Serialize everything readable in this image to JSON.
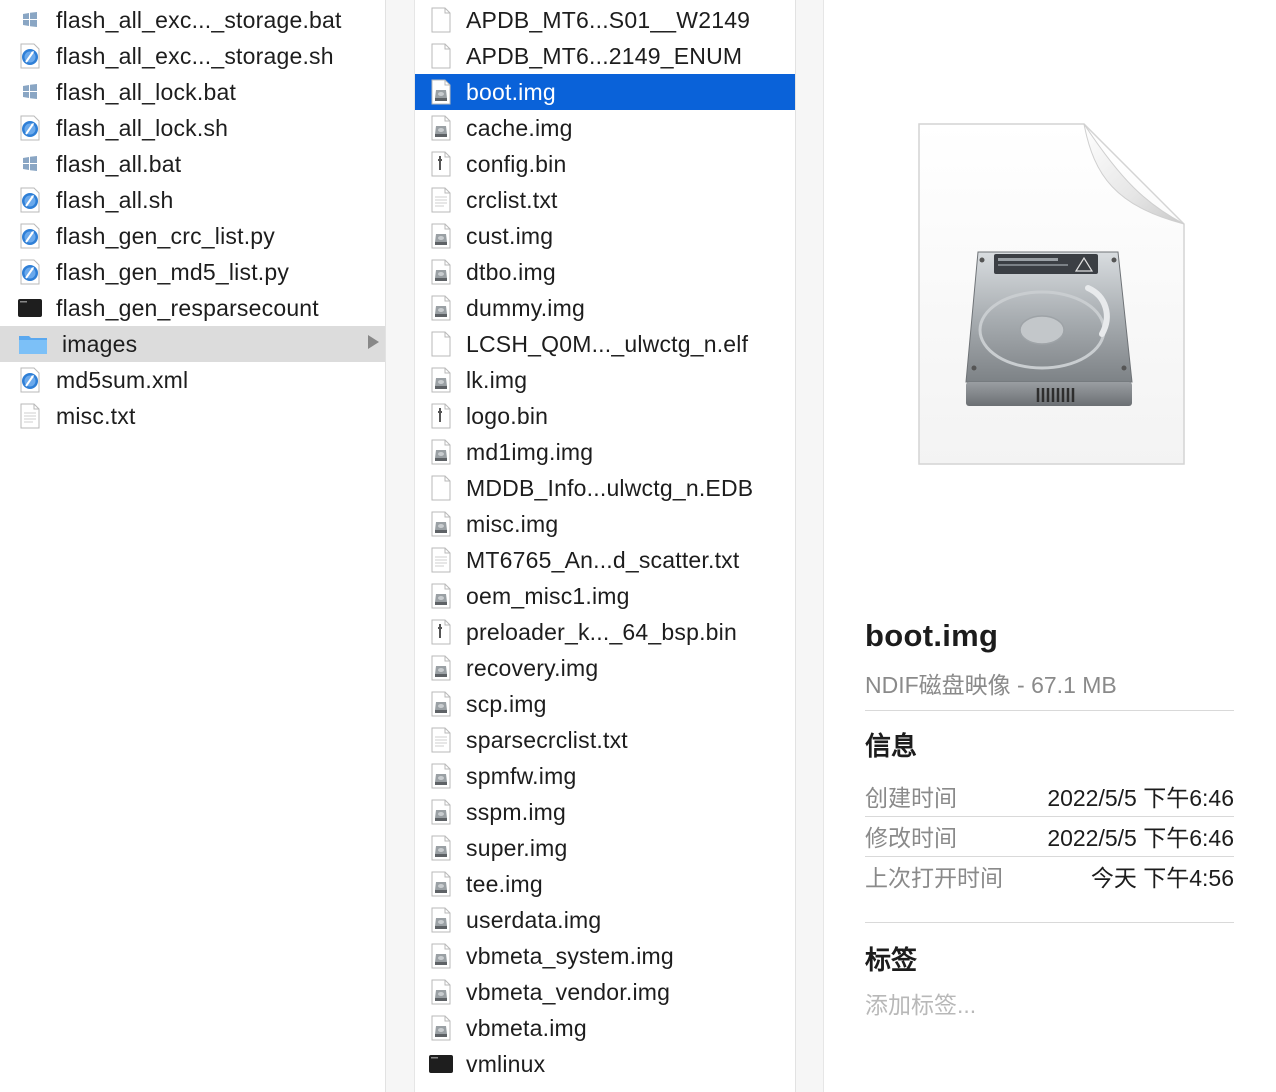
{
  "column1": {
    "items": [
      {
        "label": "flash_all_exc..._storage.bat",
        "icon": "windows-bat-icon"
      },
      {
        "label": "flash_all_exc..._storage.sh",
        "icon": "shell-script-icon"
      },
      {
        "label": "flash_all_lock.bat",
        "icon": "windows-bat-icon"
      },
      {
        "label": "flash_all_lock.sh",
        "icon": "shell-script-icon"
      },
      {
        "label": "flash_all.bat",
        "icon": "windows-bat-icon"
      },
      {
        "label": "flash_all.sh",
        "icon": "shell-script-icon"
      },
      {
        "label": "flash_gen_crc_list.py",
        "icon": "shell-script-icon"
      },
      {
        "label": "flash_gen_md5_list.py",
        "icon": "shell-script-icon"
      },
      {
        "label": "flash_gen_resparsecount",
        "icon": "terminal-exec-icon"
      },
      {
        "label": "images",
        "icon": "folder-icon"
      },
      {
        "label": "md5sum.xml",
        "icon": "shell-script-icon"
      },
      {
        "label": "misc.txt",
        "icon": "text-doc-icon"
      }
    ]
  },
  "column2": {
    "items": [
      {
        "label": "APDB_MT6...S01__W2149",
        "icon": "blank-doc-icon"
      },
      {
        "label": "APDB_MT6...2149_ENUM",
        "icon": "blank-doc-icon"
      },
      {
        "label": "boot.img",
        "icon": "disk-image-icon"
      },
      {
        "label": "cache.img",
        "icon": "disk-image-icon"
      },
      {
        "label": "config.bin",
        "icon": "binary-doc-icon"
      },
      {
        "label": "crclist.txt",
        "icon": "text-doc-icon"
      },
      {
        "label": "cust.img",
        "icon": "disk-image-icon"
      },
      {
        "label": "dtbo.img",
        "icon": "disk-image-icon"
      },
      {
        "label": "dummy.img",
        "icon": "disk-image-icon"
      },
      {
        "label": "LCSH_Q0M..._ulwctg_n.elf",
        "icon": "blank-doc-icon"
      },
      {
        "label": "lk.img",
        "icon": "disk-image-icon"
      },
      {
        "label": "logo.bin",
        "icon": "binary-doc-icon"
      },
      {
        "label": "md1img.img",
        "icon": "disk-image-icon"
      },
      {
        "label": "MDDB_Info...ulwctg_n.EDB",
        "icon": "blank-doc-icon"
      },
      {
        "label": "misc.img",
        "icon": "disk-image-icon"
      },
      {
        "label": "MT6765_An...d_scatter.txt",
        "icon": "text-doc-icon"
      },
      {
        "label": "oem_misc1.img",
        "icon": "disk-image-icon"
      },
      {
        "label": "preloader_k..._64_bsp.bin",
        "icon": "binary-doc-icon"
      },
      {
        "label": "recovery.img",
        "icon": "disk-image-icon"
      },
      {
        "label": "scp.img",
        "icon": "disk-image-icon"
      },
      {
        "label": "sparsecrclist.txt",
        "icon": "text-doc-icon"
      },
      {
        "label": "spmfw.img",
        "icon": "disk-image-icon"
      },
      {
        "label": "sspm.img",
        "icon": "disk-image-icon"
      },
      {
        "label": "super.img",
        "icon": "disk-image-icon"
      },
      {
        "label": "tee.img",
        "icon": "disk-image-icon"
      },
      {
        "label": "userdata.img",
        "icon": "disk-image-icon"
      },
      {
        "label": "vbmeta_system.img",
        "icon": "disk-image-icon"
      },
      {
        "label": "vbmeta_vendor.img",
        "icon": "disk-image-icon"
      },
      {
        "label": "vbmeta.img",
        "icon": "disk-image-icon"
      },
      {
        "label": "vmlinux",
        "icon": "terminal-exec-icon"
      }
    ]
  },
  "preview": {
    "title": "boot.img",
    "subtitle": "NDIF磁盘映像 - 67.1 MB",
    "info_heading": "信息",
    "info": [
      {
        "key": "创建时间",
        "value": "2022/5/5 下午6:46"
      },
      {
        "key": "修改时间",
        "value": "2022/5/5 下午6:46"
      },
      {
        "key": "上次打开时间",
        "value": "今天 下午4:56"
      }
    ],
    "tags_heading": "标签",
    "tags_placeholder": "添加标签..."
  },
  "colors": {
    "selection": "#0a62d9",
    "folder_selection": "#dcdcdc",
    "folder_blue": "#6cb6f2"
  }
}
